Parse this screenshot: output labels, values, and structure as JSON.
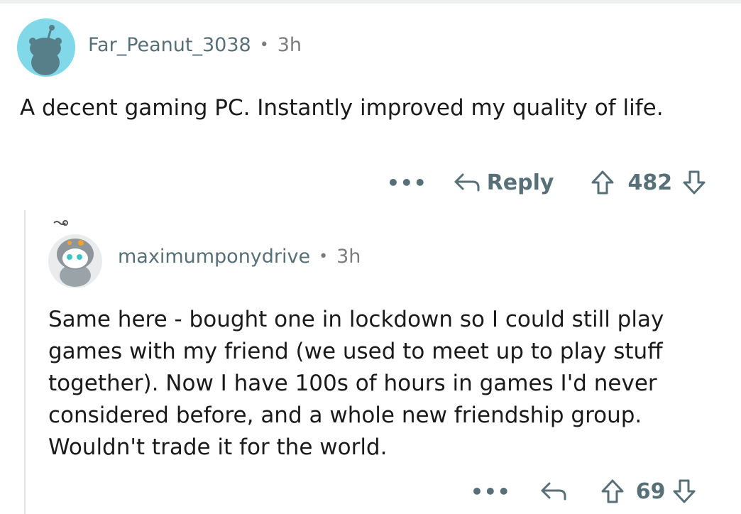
{
  "parent": {
    "username": "Far_Peanut_3038",
    "separator": "•",
    "time": "3h",
    "text": "A decent gaming PC. Instantly improved my quality of life.",
    "more": "•••",
    "reply_label": "Reply",
    "votes": "482",
    "avatar_color": "#80d8e8"
  },
  "reply": {
    "username": "maximumponydrive",
    "separator": "•",
    "time": "3h",
    "text": "Same here - bought one in lockdown so I could still play games with my friend (we used to meet up to play stuff together). Now I have 100s of hours in games I'd never considered before, and a whole new friendship group. Wouldn't trade it for the world.",
    "more": "•••",
    "votes": "69"
  },
  "icons": {
    "reply": "reply-arrow-icon",
    "upvote": "upvote-arrow-icon",
    "downvote": "downvote-arrow-icon",
    "more": "more-dots-icon"
  }
}
